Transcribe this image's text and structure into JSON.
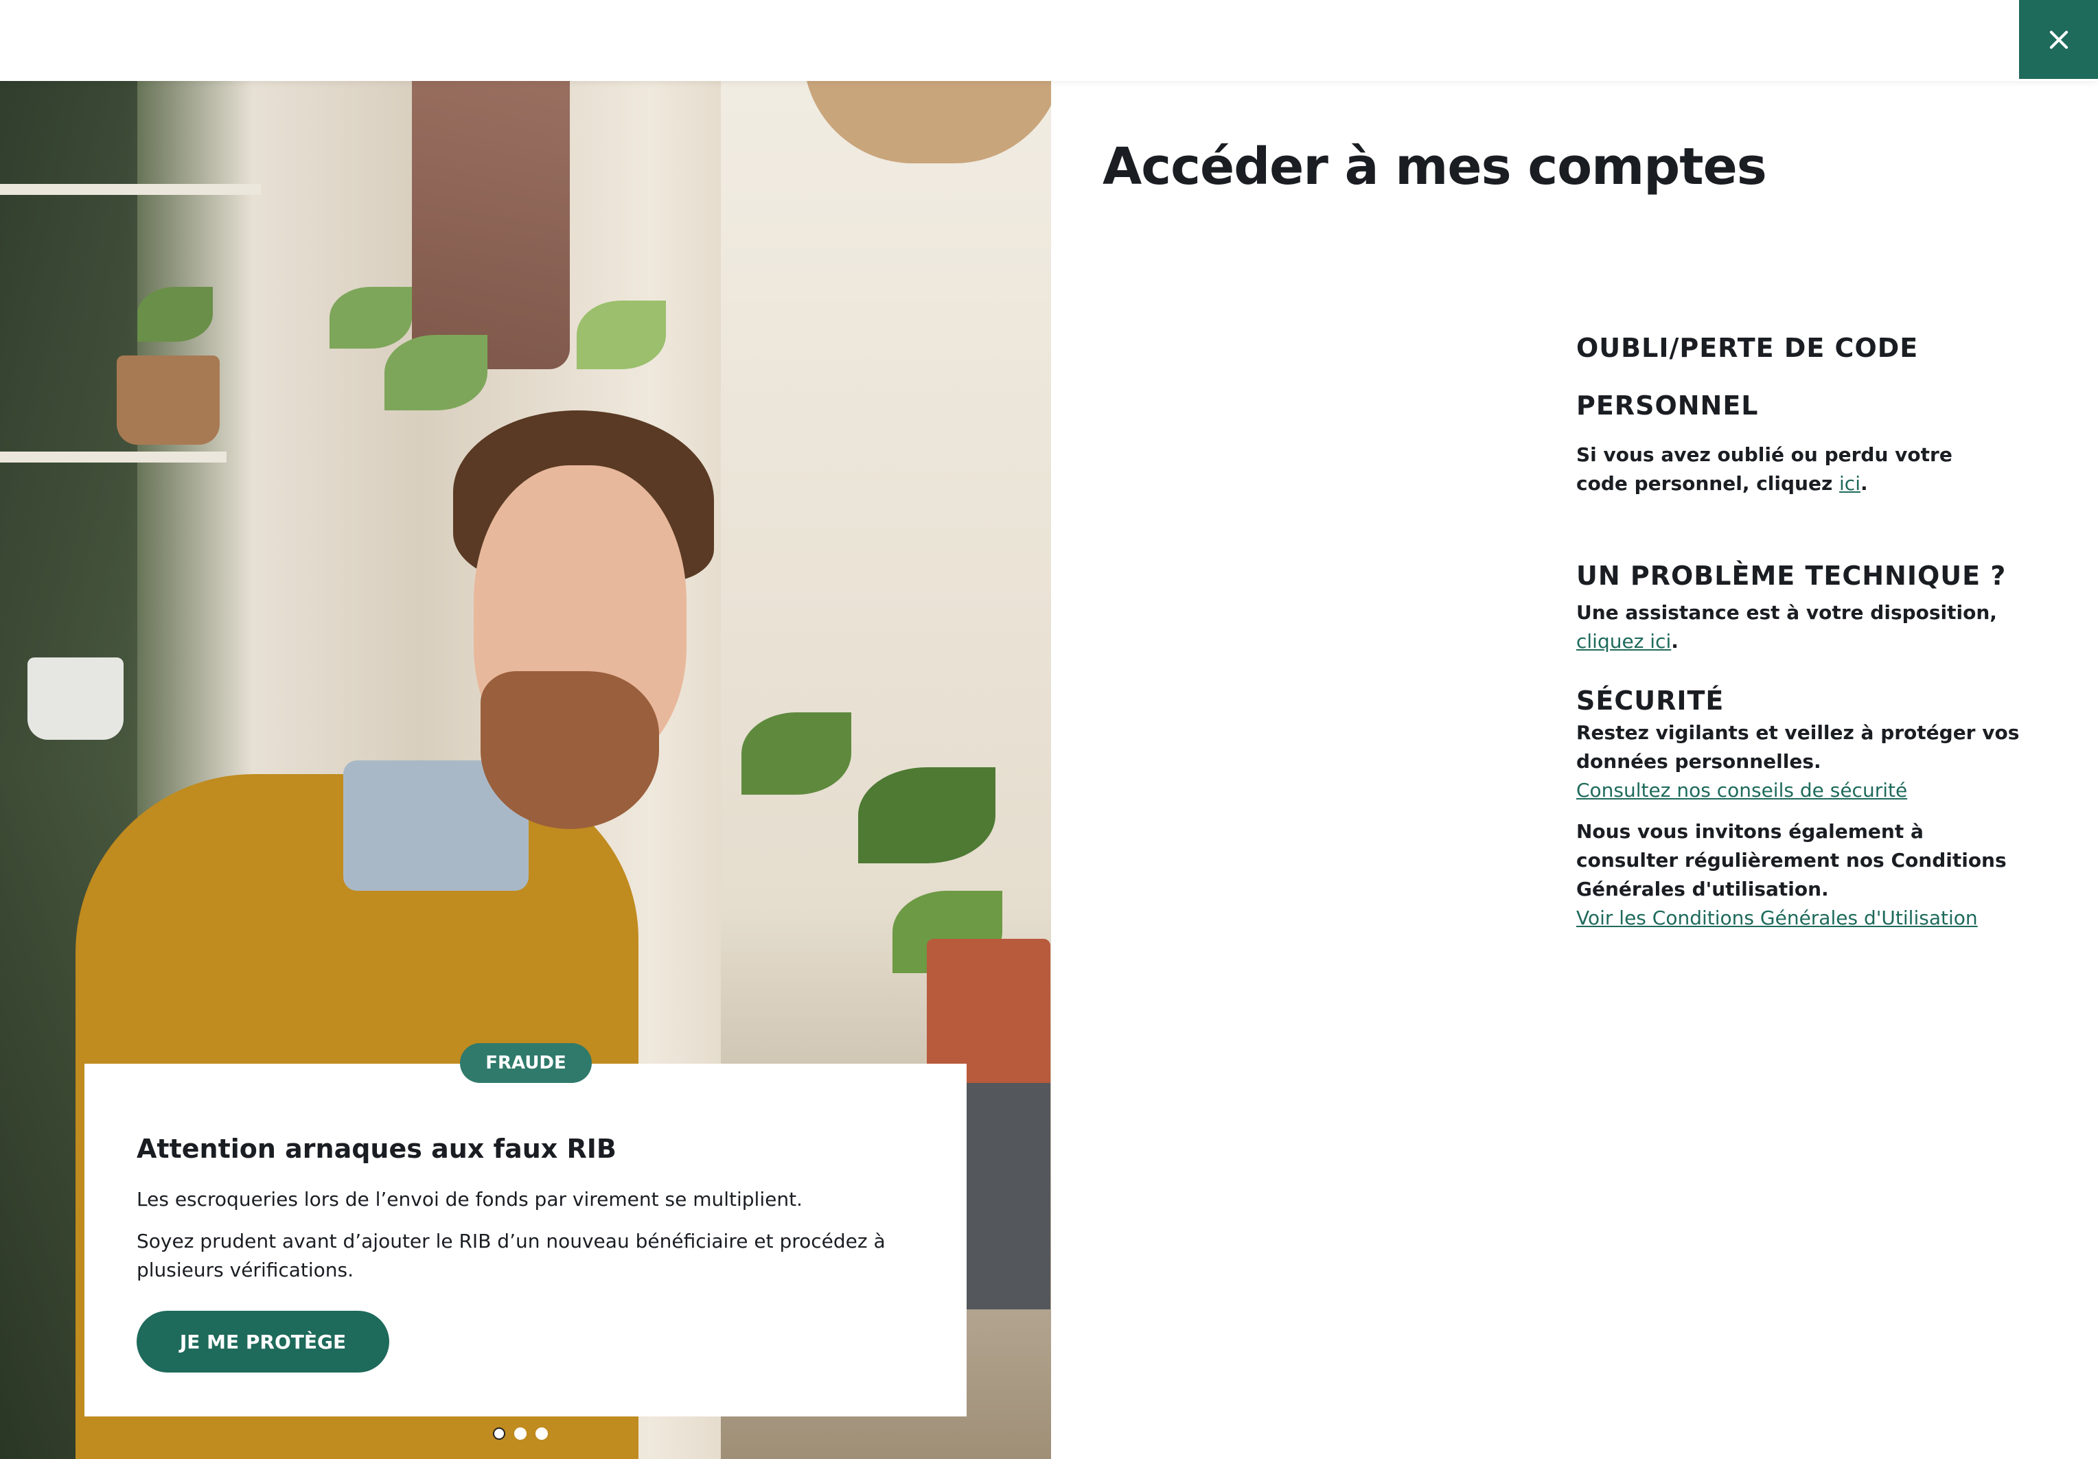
{
  "header": {
    "close_icon": "close-icon"
  },
  "page": {
    "title": "Accéder à mes comptes"
  },
  "promo": {
    "badge": "FRAUDE",
    "title": "Attention arnaques aux faux RIB",
    "paragraph1": "Les escroqueries lors de l’envoi de fonds par virement se multiplient.",
    "paragraph2": "Soyez prudent avant d’ajouter le RIB d’un nouveau bénéficiaire et procédez à plusieurs vérifications.",
    "cta": "JE ME PROTÈGE",
    "carousel_slides": 3,
    "carousel_active": 1
  },
  "help": {
    "lost_code": {
      "title_line1": "OUBLI/PERTE DE CODE",
      "title_line2": "PERSONNEL",
      "text": "Si vous avez oublié ou perdu votre code personnel, cliquez ",
      "link": "ici",
      "suffix": "."
    },
    "tech": {
      "title": "UN PROBLÈME TECHNIQUE ?",
      "text": "Une assistance est à votre disposition, ",
      "link": "cliquez ici",
      "suffix": "."
    },
    "security": {
      "title": "SÉCURITÉ",
      "text1": "Restez vigilants et veillez à protéger vos données personnelles.",
      "link1": "Consultez nos conseils de sécurité",
      "text2": "Nous vous invitons également à consulter régulièrement nos Conditions Générales d'utilisation.",
      "link2": "Voir les Conditions Générales d'Utilisation"
    }
  },
  "colors": {
    "brand_green": "#1e6a5b",
    "badge_green": "#2f7a6b",
    "text_dark": "#1a1d22"
  }
}
